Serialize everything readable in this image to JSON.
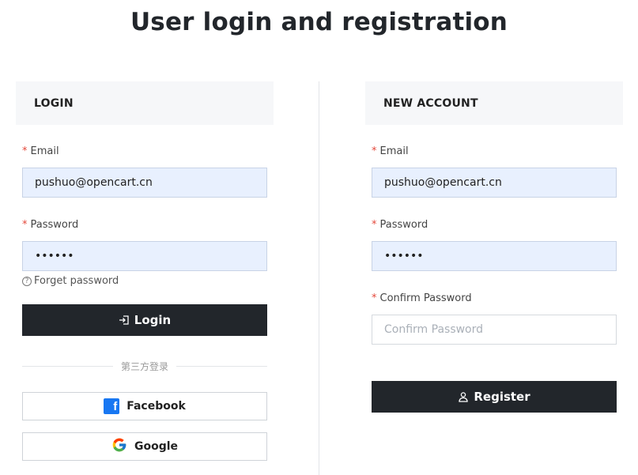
{
  "page": {
    "title": "User login and registration"
  },
  "login": {
    "header": "LOGIN",
    "email_label": "Email",
    "email_value": "pushuo@opencart.cn",
    "password_label": "Password",
    "password_value": "123456",
    "forget_label": "Forget password",
    "login_button": "Login",
    "third_party_label": "第三方登录",
    "facebook_button": "Facebook",
    "google_button": "Google"
  },
  "register": {
    "header": "NEW ACCOUNT",
    "email_label": "Email",
    "email_value": "pushuo@opencart.cn",
    "password_label": "Password",
    "password_value": "123456",
    "confirm_label": "Confirm Password",
    "confirm_placeholder": "Confirm Password",
    "register_button": "Register"
  },
  "required_marker": "*",
  "icons": {
    "login": "login-arrow-icon",
    "register": "user-icon",
    "facebook": "facebook-icon",
    "google": "google-icon",
    "forget": "question-circle-icon"
  },
  "colors": {
    "accent_dark": "#22262b",
    "required": "#e4483b",
    "facebook": "#1877f2"
  }
}
